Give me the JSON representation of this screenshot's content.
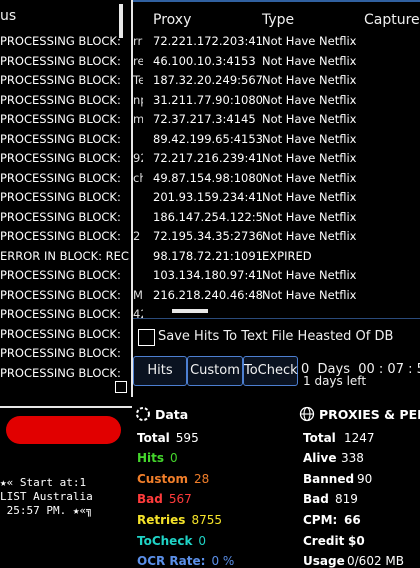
{
  "status_panel": {
    "header": "us",
    "rows": [
      "PROCESSING BLOCK:",
      "PROCESSING BLOCK:",
      "PROCESSING BLOCK:",
      "PROCESSING BLOCK:",
      "PROCESSING BLOCK:",
      "PROCESSING BLOCK:",
      "PROCESSING BLOCK:",
      "PROCESSING BLOCK:",
      "PROCESSING BLOCK:",
      "PROCESSING BLOCK:",
      "PROCESSING BLOCK:",
      "ERROR IN BLOCK: REC",
      "PROCESSING BLOCK:",
      "PROCESSING BLOCK:",
      "PROCESSING BLOCK:",
      "PROCESSING BLOCK:",
      "PROCESSING BLOCK:",
      "PROCESSING BLOCK:"
    ]
  },
  "table": {
    "headers": {
      "proxy": "Proxy",
      "type": "Type",
      "capture": "Capture"
    },
    "status_fragments": [
      "rr",
      "re",
      "Te",
      "np",
      "m",
      "",
      "92",
      "ch",
      "",
      "",
      "2",
      "",
      "",
      "Me",
      "42"
    ],
    "rows": [
      {
        "proxy": "72.221.172.203:41",
        "type": "Not Have Netflix"
      },
      {
        "proxy": "46.100.10.3:4153",
        "type": "Not Have Netflix"
      },
      {
        "proxy": "187.32.20.249:567",
        "type": "Not Have Netflix"
      },
      {
        "proxy": "31.211.77.90:1080",
        "type": "Not Have Netflix"
      },
      {
        "proxy": "72.37.217.3:4145",
        "type": "Not Have Netflix"
      },
      {
        "proxy": "89.42.199.65:4153",
        "type": "Not Have Netflix"
      },
      {
        "proxy": "72.217.216.239:41",
        "type": "Not Have Netflix"
      },
      {
        "proxy": "49.87.154.98:1080",
        "type": "Not Have Netflix"
      },
      {
        "proxy": "201.93.159.234:41",
        "type": "Not Have Netflix"
      },
      {
        "proxy": "186.147.254.122:5",
        "type": "Not Have Netflix"
      },
      {
        "proxy": "72.195.34.35:2736",
        "type": "Not Have Netflix"
      },
      {
        "proxy": "98.178.72.21:1091",
        "type": "EXPIRED"
      },
      {
        "proxy": "103.134.180.97:41",
        "type": "Not Have Netflix"
      },
      {
        "proxy": "216.218.240.46:48",
        "type": "Not Have Netflix"
      }
    ]
  },
  "options": {
    "save_hits_label": "Save Hits To Text File Heasted Of DB"
  },
  "buttons": {
    "hits": "Hits",
    "custom": "Custom",
    "tocheck": "ToCheck"
  },
  "timer": {
    "text": "0  Days  00 : 07 : 5",
    "days_left": "1 days left"
  },
  "info": {
    "line1": "★« Start at:1",
    "line2": "LIST Australia",
    "line3": " 25:57 PM. ★«╗"
  },
  "data_stats": {
    "title": "Data",
    "total": {
      "label": "Total",
      "value": "595",
      "color": "#ffffff"
    },
    "hits": {
      "label": "Hits",
      "value": "0",
      "color": "#44d62c"
    },
    "custom": {
      "label": "Custom",
      "value": "28",
      "color": "#f07e2a"
    },
    "bad": {
      "label": "Bad",
      "value": "567",
      "color": "#ff3b3b"
    },
    "retries": {
      "label": "Retries",
      "value": "8755",
      "color": "#f5e32a"
    },
    "tocheck": {
      "label": "ToCheck",
      "value": "0",
      "color": "#1fd3c6"
    },
    "ocr": {
      "label": "OCR Rate:",
      "value": "0 %",
      "color": "#5b8fe8"
    }
  },
  "proxy_stats": {
    "title": "PROXIES & PERF",
    "total": {
      "label": "Total",
      "value": "1247"
    },
    "alive": {
      "label": "Alive",
      "value": "338"
    },
    "banned": {
      "label": "Banned",
      "value": "90"
    },
    "bad": {
      "label": "Bad",
      "value": "819"
    },
    "cpm": {
      "label": "CPM:",
      "value": "66"
    },
    "credit": {
      "label": "Credit",
      "value": "$0"
    },
    "usage": {
      "label": "Usage",
      "value": "0/602 MB"
    }
  }
}
